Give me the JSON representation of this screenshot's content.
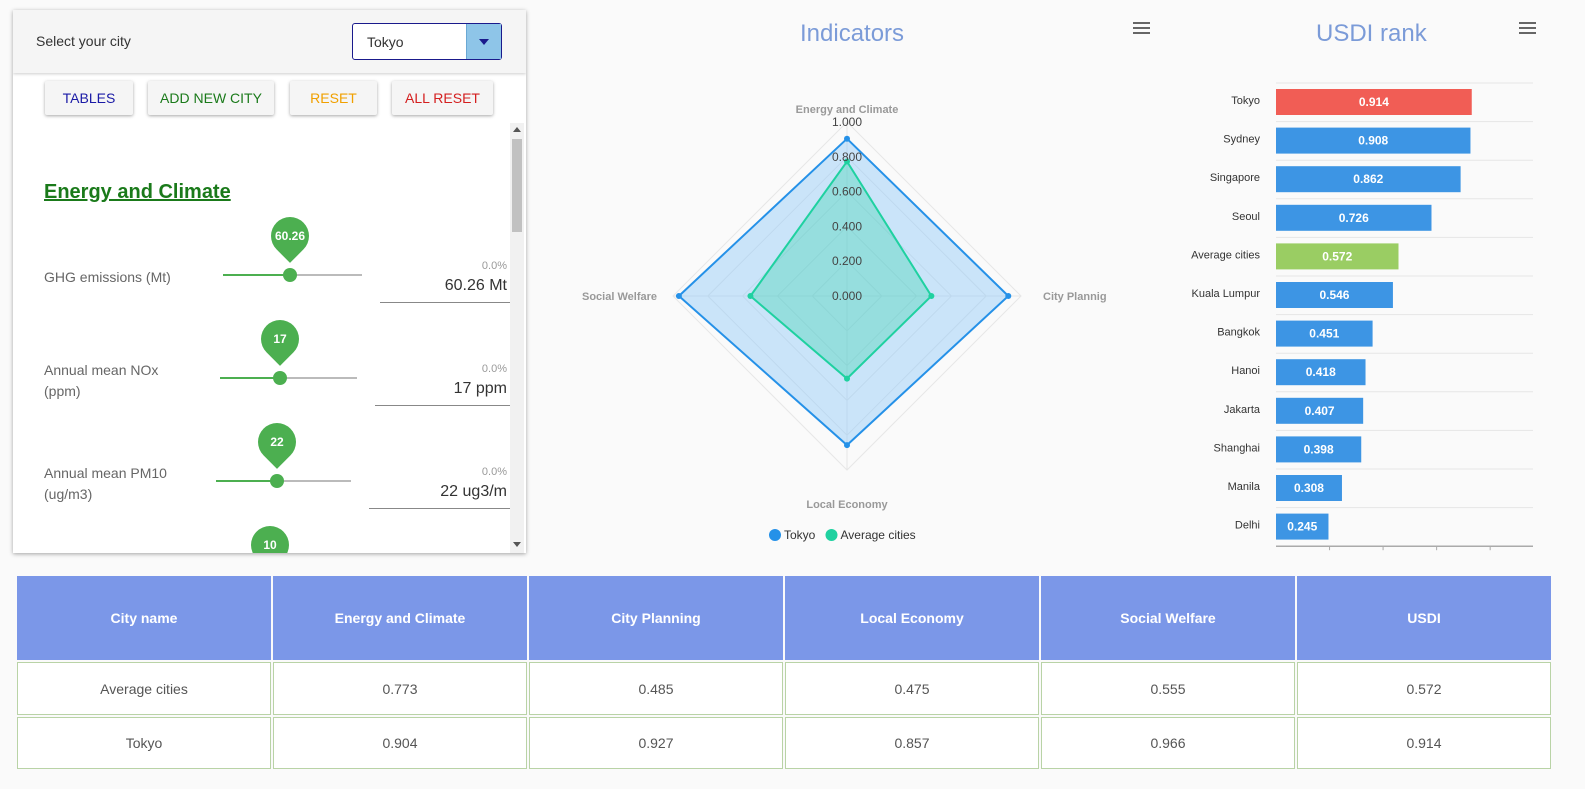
{
  "city_select": {
    "label": "Select your city",
    "value": "Tokyo"
  },
  "buttons": {
    "tables": "TABLES",
    "add": "ADD NEW CITY",
    "reset": "RESET",
    "all_reset": "ALL RESET"
  },
  "section_title": "Energy and Climate",
  "sliders": [
    {
      "label": "GHG emissions (Mt)",
      "value": 60.26,
      "bubble": "60.26",
      "pct": "0.0%",
      "display": "60.26 Mt",
      "fraction": 0.48
    },
    {
      "label": "Annual mean NOx (ppm)",
      "value": 17,
      "bubble": "17",
      "pct": "0.0%",
      "display": "17 ppm",
      "fraction": 0.44
    },
    {
      "label": "Annual mean PM10 (ug/m3)",
      "value": 22,
      "bubble": "22",
      "pct": "0.0%",
      "display": "22 ug3/m",
      "fraction": 0.45
    },
    {
      "bubble": "10"
    }
  ],
  "colors": {
    "tokyo": "#2591e8",
    "average": "#1fd1a0",
    "highlight": "#f15d55",
    "bar": "#3d95e4",
    "avg_bar": "#9acd63",
    "header": "#7b97e8"
  },
  "chart_data": [
    {
      "type": "radar",
      "title": "Indicators",
      "axes": [
        "Energy and Climate",
        "City Plannig",
        "Local Economy",
        "Social Welfare"
      ],
      "ticks": [
        "0.000",
        "0.200",
        "0.400",
        "0.600",
        "0.800",
        "1.000"
      ],
      "range": [
        0,
        1
      ],
      "series": [
        {
          "name": "Tokyo",
          "values": [
            0.904,
            0.927,
            0.857,
            0.966
          ]
        },
        {
          "name": "Average cities",
          "values": [
            0.773,
            0.485,
            0.475,
            0.555
          ]
        }
      ],
      "legend": "bottom"
    },
    {
      "type": "bar",
      "title": "USDI rank",
      "orientation": "horizontal",
      "categories": [
        "Tokyo",
        "Sydney",
        "Singapore",
        "Seoul",
        "Average cities",
        "Kuala Lumpur",
        "Bangkok",
        "Hanoi",
        "Jakarta",
        "Shanghai",
        "Manila",
        "Delhi"
      ],
      "values": [
        0.914,
        0.908,
        0.862,
        0.726,
        0.572,
        0.546,
        0.451,
        0.418,
        0.407,
        0.398,
        0.308,
        0.245
      ],
      "labels": [
        "0.914",
        "0.908",
        "0.862",
        "0.726",
        "0.572",
        "0.546",
        "0.451",
        "0.418",
        "0.407",
        "0.398",
        "0.308",
        "0.245"
      ],
      "highlight": "Tokyo",
      "xlim": [
        0,
        1.2
      ]
    },
    {
      "type": "table",
      "columns": [
        "City name",
        "Energy and Climate",
        "City Planning",
        "Local Economy",
        "Social Welfare",
        "USDI"
      ],
      "rows": [
        [
          "Average cities",
          "0.773",
          "0.485",
          "0.475",
          "0.555",
          "0.572"
        ],
        [
          "Tokyo",
          "0.904",
          "0.927",
          "0.857",
          "0.966",
          "0.914"
        ]
      ]
    }
  ]
}
